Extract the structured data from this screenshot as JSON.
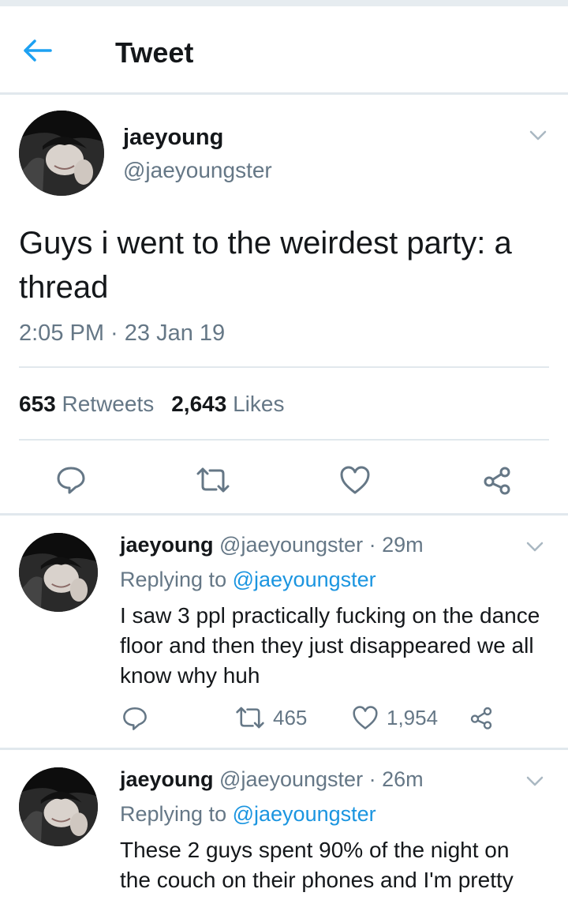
{
  "header": {
    "title": "Tweet"
  },
  "main_tweet": {
    "name": "jaeyoung",
    "handle": "@jaeyoungster",
    "text": "Guys i went to the weirdest party: a thread",
    "time": "2:05 PM · 23 Jan 19",
    "retweets_count": "653",
    "retweets_label": "Retweets",
    "likes_count": "2,643",
    "likes_label": "Likes"
  },
  "replies": [
    {
      "name": "jaeyoung",
      "handle": "@jaeyoungster",
      "age": "· 29m",
      "replying_label": "Replying to",
      "replying_handle": "@jaeyoungster",
      "text": "I saw 3 ppl practically fucking on the dance floor and then they just disappeared we all know why huh",
      "retweets": "465",
      "likes": "1,954"
    },
    {
      "name": "jaeyoung",
      "handle": "@jaeyoungster",
      "age": "· 26m",
      "replying_label": "Replying to",
      "replying_handle": "@jaeyoungster",
      "text": "These 2 guys spent 90% of the night on the couch on their phones and I'm pretty"
    }
  ],
  "colors": {
    "accent": "#1da1f2",
    "link": "#1b95e0",
    "secondary_text": "#657786",
    "divider": "#e1e8ed"
  },
  "icons": {
    "back": "arrow-left-icon",
    "caret": "chevron-down-icon",
    "reply": "reply-bubble-icon",
    "retweet": "retweet-icon",
    "like": "heart-icon",
    "share": "share-icon"
  }
}
